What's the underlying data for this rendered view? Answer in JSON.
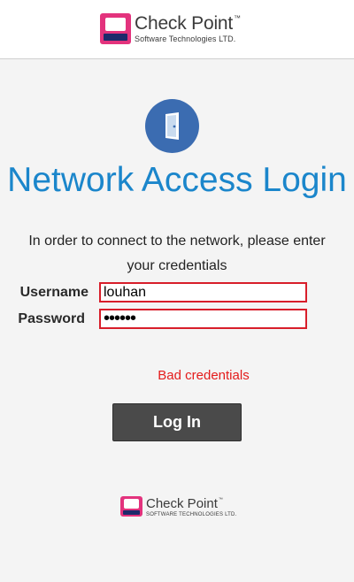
{
  "header": {
    "logo": {
      "brand": "Check Point",
      "trademark": "™",
      "subtitle": "Software Technologies LTD."
    }
  },
  "icon": "door-icon",
  "title": "Network Access Login",
  "intro": "In order to connect to the network, please enter your credentials",
  "form": {
    "username_label": "Username",
    "username_value": "louhan",
    "password_label": "Password",
    "password_value": "••••••",
    "error": "Bad credentials",
    "login_label": "Log In"
  },
  "footer": {
    "logo": {
      "brand": "Check Point",
      "trademark": "™",
      "subtitle": "SOFTWARE TECHNOLOGIES LTD."
    }
  },
  "colors": {
    "title": "#1b86cb",
    "error": "#e41b1b",
    "input_border": "#d81e2a",
    "button": "#4a4a4a",
    "logo_accent": "#e3337d"
  }
}
